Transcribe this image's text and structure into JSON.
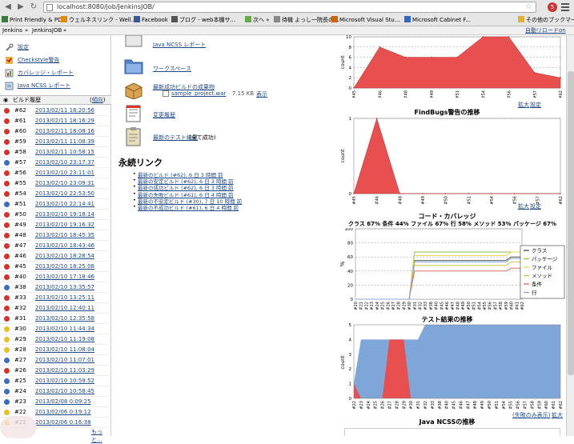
{
  "browser": {
    "url": "localhost:8080/job/JenkinsJOB/",
    "badge": "5",
    "bookmarks": [
      {
        "label": "Print Friendly & PDF",
        "color": "#3a7a3a"
      },
      {
        "label": "ウェルネスリンク - Well...",
        "color": "#e28a00"
      },
      {
        "label": "Facebook",
        "color": "#3b5998"
      },
      {
        "label": "ブログ - web本棚サ...",
        "color": "#555"
      },
      {
        "label": "次へ »",
        "color": "#6a4"
      },
      {
        "label": "待機 よっし一院長の...",
        "color": "#888"
      },
      {
        "label": "Microsoft Visual Stu...",
        "color": "#c60"
      },
      {
        "label": "Microsoft Cabinet F...",
        "color": "#36c"
      },
      {
        "label": "その他のブックマーク",
        "color": "#e0b040"
      }
    ]
  },
  "breadcrumb": {
    "items": [
      "Jenkins",
      "JenkinsJOB"
    ],
    "autorefresh": "自動リロードon"
  },
  "sidebar": {
    "tasks": [
      {
        "label": "設定",
        "icon": "wrench-icon",
        "color": "#888"
      },
      {
        "label": "Checkstyle警告",
        "icon": "checkstyle-icon",
        "color": "#d93"
      },
      {
        "label": "カバレッジ・レポート",
        "icon": "coverage-icon",
        "color": "#888"
      },
      {
        "label": "Java NCSS レポート",
        "icon": "ncss-icon",
        "color": "#68a"
      }
    ],
    "history_title": "ビルド履歴",
    "history_trend": "傾向",
    "builds": [
      {
        "num": "#62",
        "date": "2013/02/11 18:20:56",
        "status": "red"
      },
      {
        "num": "#61",
        "date": "2013/02/11 18:16:29",
        "status": "red"
      },
      {
        "num": "#60",
        "date": "2013/02/11 18:08:16",
        "status": "red"
      },
      {
        "num": "#59",
        "date": "2013/02/11 11:08:39",
        "status": "red"
      },
      {
        "num": "#58",
        "date": "2013/02/11 10:58:15",
        "status": "red"
      },
      {
        "num": "#57",
        "date": "2013/02/10 23:17:37",
        "status": "blue"
      },
      {
        "num": "#56",
        "date": "2013/02/10 23:11:01",
        "status": "red"
      },
      {
        "num": "#55",
        "date": "2013/02/10 23:09:31",
        "status": "red"
      },
      {
        "num": "#54",
        "date": "2013/02/10 22:53:50",
        "status": "red"
      },
      {
        "num": "#51",
        "date": "2013/02/10 22:14:41",
        "status": "blue"
      },
      {
        "num": "#50",
        "date": "2013/02/10 19:18:14",
        "status": "red"
      },
      {
        "num": "#49",
        "date": "2013/02/10 19:16:32",
        "status": "red"
      },
      {
        "num": "#48",
        "date": "2013/02/10 18:45:35",
        "status": "red"
      },
      {
        "num": "#47",
        "date": "2013/02/10 18:43:46",
        "status": "red"
      },
      {
        "num": "#46",
        "date": "2013/02/10 18:28:54",
        "status": "red"
      },
      {
        "num": "#45",
        "date": "2013/02/10 18:25:08",
        "status": "red"
      },
      {
        "num": "#40",
        "date": "2013/02/10 17:18:46",
        "status": "red"
      },
      {
        "num": "#38",
        "date": "2013/02/10 13:35:57",
        "status": "blue"
      },
      {
        "num": "#33",
        "date": "2013/02/10 13:25:11",
        "status": "red"
      },
      {
        "num": "#32",
        "date": "2013/02/10 12:40:11",
        "status": "red"
      },
      {
        "num": "#31",
        "date": "2013/02/10 12:35:58",
        "status": "red"
      },
      {
        "num": "#30",
        "date": "2013/02/10 11:44:34",
        "status": "yellow"
      },
      {
        "num": "#29",
        "date": "2013/02/10 11:19:08",
        "status": "yellow"
      },
      {
        "num": "#28",
        "date": "2013/02/10 11:08:04",
        "status": "yellow"
      },
      {
        "num": "#27",
        "date": "2013/02/10 11:07:01",
        "status": "blue"
      },
      {
        "num": "#26",
        "date": "2013/02/10 11:03:29",
        "status": "red"
      },
      {
        "num": "#25",
        "date": "2013/02/10 10:59:52",
        "status": "blue"
      },
      {
        "num": "#24",
        "date": "2013/02/10 10:58:45",
        "status": "blue"
      },
      {
        "num": "#23",
        "date": "2013/02/08 0:09:25",
        "status": "blue"
      },
      {
        "num": "#22",
        "date": "2013/02/06 0:19:12",
        "status": "yellow"
      },
      {
        "num": "#21",
        "date": "2013/02/06 0:16:38",
        "status": "yellow"
      }
    ],
    "history_more": "もっと..."
  },
  "center": {
    "ncss_link": "Java NCSS レポート",
    "workspace_link": "ワークスペース",
    "artifacts_link": "最新成功ビルドの成果物",
    "artifact_file": "sample_project.war",
    "artifact_size": "7.15 KB",
    "artifact_view": "表示",
    "changes_link": "変更履歴",
    "test_link": "最新のテスト結果",
    "test_note": "(全て成功)",
    "perm_title": "永続リンク",
    "permalinks": [
      "最新のビルド (#62), 6 日 3 時間 前",
      "最新の安定ビルド (#62), 6 日 3 時間 前",
      "最新の成功ビルド (#62), 6 日 3 時間 前",
      "最新の失敗ビルド (#61), 6 日 4 時間 前",
      "最新の不安定ビルド (#30), 7 日 10 時間 前",
      "最新の不成功ビルド (#61), 6 日 4 時間 前"
    ]
  },
  "charts": {
    "links_enlarge": "拡大",
    "links_settings": "設定",
    "checkstyle": {
      "ylabel": "count",
      "ymax": 10,
      "yticks": [
        0,
        2,
        4,
        6,
        8,
        10
      ],
      "xticks": [
        "#45",
        "#46",
        "#48",
        "#49",
        "#51",
        "#54",
        "#56",
        "#57",
        "#62"
      ],
      "fill": "#e85050"
    },
    "findbugs": {
      "title": "FindBugs警告の推移",
      "ylabel": "count",
      "ymax": 1,
      "yticks": [
        0,
        1
      ],
      "xticks": [
        "#45",
        "#46",
        "#48",
        "#49",
        "#50",
        "#51",
        "#54",
        "#56",
        "#57",
        "#62"
      ],
      "fill": "#e85050"
    },
    "coverage": {
      "title": "コード・カバレッジ",
      "summary": "クラス  67% 条件  44% ファイル  67% 行  58% メソッド  53% パッケージ  67%",
      "ylabel": "%",
      "ymax": 100,
      "yticks": [
        0,
        20,
        40,
        60,
        80,
        100
      ],
      "xticks": [
        "#20",
        "#21",
        "#22",
        "#23",
        "#24",
        "#25",
        "#26",
        "#27",
        "#28",
        "#29",
        "#30",
        "#31",
        "#32",
        "#33",
        "#38",
        "#40",
        "#45",
        "#46",
        "#47",
        "#48",
        "#49",
        "#50",
        "#51",
        "#54",
        "#55",
        "#56",
        "#57",
        "#58",
        "#59",
        "#60",
        "#61",
        "#62"
      ],
      "legend": [
        {
          "name": "クラス",
          "color": "#555555"
        },
        {
          "name": "パッケージ",
          "color": "#8fbf3f"
        },
        {
          "name": "ファイル",
          "color": "#e8d84a"
        },
        {
          "name": "メソッド",
          "color": "#c8c84a"
        },
        {
          "name": "条件",
          "color": "#e07060"
        },
        {
          "name": "行",
          "color": "#8aa4d0"
        }
      ]
    },
    "tests": {
      "title": "テスト結果の推移",
      "ylabel": "count",
      "ymax": 5,
      "yticks": [
        0,
        1,
        2,
        3,
        4,
        5
      ],
      "xticks": [
        "#22",
        "#23",
        "#24",
        "#25",
        "#26",
        "#27",
        "#28",
        "#29",
        "#30",
        "#31",
        "#32",
        "#33",
        "#38",
        "#40",
        "#45",
        "#46",
        "#47",
        "#48",
        "#49",
        "#50",
        "#51",
        "#54",
        "#55",
        "#56",
        "#57",
        "#58",
        "#59",
        "#60",
        "#61",
        "#62"
      ],
      "pass_color": "#7fa6d8",
      "fail_color": "#e85050",
      "show_failed_only": "(失敗のみ表示)"
    },
    "ncss_title": "Java NCSSの推移"
  },
  "chart_data": [
    {
      "type": "area",
      "title": "",
      "ylabel": "count",
      "ylim": [
        0,
        10
      ],
      "x": [
        "#45",
        "#46",
        "#48",
        "#49",
        "#51",
        "#54",
        "#56",
        "#57",
        "#62"
      ],
      "values": [
        0,
        8,
        6,
        6,
        6,
        10,
        10,
        3,
        2
      ]
    },
    {
      "type": "area",
      "title": "FindBugs警告の推移",
      "ylabel": "count",
      "ylim": [
        0,
        1
      ],
      "x": [
        "#45",
        "#46",
        "#48",
        "#49",
        "#50",
        "#51",
        "#54",
        "#56",
        "#57",
        "#62"
      ],
      "values": [
        0,
        1,
        0,
        0,
        0,
        0,
        0,
        0,
        0,
        0
      ]
    },
    {
      "type": "line",
      "title": "コード・カバレッジ",
      "ylabel": "%",
      "ylim": [
        0,
        100
      ],
      "x": [
        "#20",
        "#21",
        "#22",
        "#23",
        "#24",
        "#25",
        "#26",
        "#27",
        "#28",
        "#29",
        "#30",
        "#31",
        "#32",
        "#33",
        "#38",
        "#40",
        "#45",
        "#46",
        "#47",
        "#48",
        "#49",
        "#50",
        "#51",
        "#54",
        "#55",
        "#56",
        "#57",
        "#58",
        "#59",
        "#60",
        "#61",
        "#62"
      ],
      "series": [
        {
          "name": "クラス",
          "values": [
            0,
            0,
            0,
            0,
            0,
            0,
            0,
            0,
            0,
            0,
            0,
            55,
            55,
            55,
            55,
            55,
            55,
            55,
            55,
            55,
            55,
            55,
            55,
            55,
            55,
            55,
            55,
            55,
            55,
            60,
            60,
            60
          ]
        },
        {
          "name": "パッケージ",
          "values": [
            0,
            0,
            0,
            0,
            0,
            0,
            0,
            0,
            0,
            0,
            0,
            67,
            67,
            67,
            67,
            67,
            67,
            67,
            67,
            67,
            67,
            67,
            67,
            67,
            67,
            67,
            67,
            67,
            67,
            67,
            67,
            67
          ]
        },
        {
          "name": "ファイル",
          "values": [
            0,
            0,
            0,
            0,
            0,
            0,
            0,
            0,
            0,
            0,
            0,
            62,
            62,
            62,
            62,
            62,
            62,
            62,
            62,
            62,
            62,
            62,
            62,
            62,
            62,
            62,
            62,
            62,
            62,
            67,
            67,
            67
          ]
        },
        {
          "name": "メソッド",
          "values": [
            0,
            0,
            0,
            0,
            0,
            0,
            0,
            0,
            0,
            0,
            0,
            48,
            48,
            48,
            48,
            48,
            48,
            48,
            48,
            48,
            48,
            48,
            48,
            48,
            48,
            48,
            48,
            48,
            48,
            53,
            53,
            53
          ]
        },
        {
          "name": "条件",
          "values": [
            0,
            0,
            0,
            0,
            0,
            0,
            0,
            0,
            0,
            0,
            0,
            40,
            40,
            40,
            40,
            40,
            40,
            40,
            40,
            40,
            40,
            40,
            40,
            40,
            40,
            40,
            40,
            40,
            40,
            44,
            44,
            44
          ]
        },
        {
          "name": "行",
          "values": [
            0,
            0,
            0,
            0,
            0,
            0,
            0,
            0,
            0,
            0,
            0,
            53,
            53,
            53,
            53,
            53,
            53,
            53,
            53,
            53,
            53,
            53,
            53,
            53,
            53,
            53,
            53,
            53,
            53,
            58,
            58,
            58
          ]
        }
      ]
    },
    {
      "type": "area",
      "title": "テスト結果の推移",
      "ylabel": "count",
      "ylim": [
        0,
        5
      ],
      "x": [
        "#22",
        "#23",
        "#24",
        "#25",
        "#26",
        "#27",
        "#28",
        "#29",
        "#30",
        "#31",
        "#32",
        "#33",
        "#38",
        "#40",
        "#45",
        "#46",
        "#47",
        "#48",
        "#49",
        "#50",
        "#51",
        "#54",
        "#55",
        "#56",
        "#57",
        "#58",
        "#59",
        "#60",
        "#61",
        "#62"
      ],
      "series": [
        {
          "name": "failed",
          "values": [
            1,
            0,
            0,
            0,
            0,
            4,
            4,
            4,
            0,
            0,
            0,
            0,
            0,
            0,
            0,
            0,
            0,
            0,
            0,
            0,
            0,
            0,
            0,
            0,
            0,
            0,
            0,
            0,
            0,
            0
          ]
        },
        {
          "name": "passed",
          "values": [
            0,
            4,
            4,
            4,
            4,
            0,
            0,
            0,
            4,
            4,
            5,
            5,
            5,
            5,
            5,
            5,
            5,
            5,
            5,
            5,
            5,
            5,
            5,
            5,
            5,
            5,
            5,
            5,
            5,
            5
          ]
        }
      ]
    }
  ]
}
